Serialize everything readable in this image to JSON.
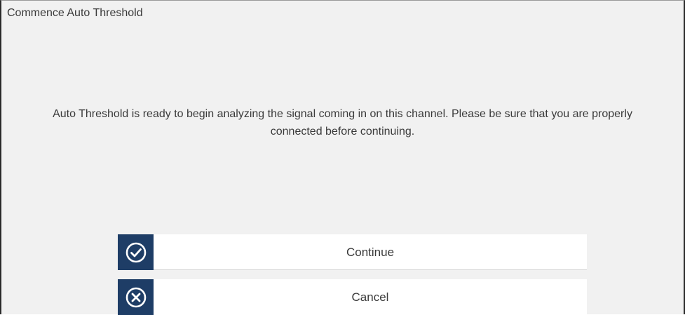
{
  "dialog": {
    "title": "Commence Auto Threshold",
    "message": "Auto Threshold is ready to begin analyzing the signal coming in on this channel. Please be sure that you are properly connected before continuing."
  },
  "buttons": {
    "continue_label": "Continue",
    "continue_icon": "checkmark-circle-icon",
    "cancel_label": "Cancel",
    "cancel_icon": "x-circle-icon",
    "icon_background": "#1e3d66"
  }
}
